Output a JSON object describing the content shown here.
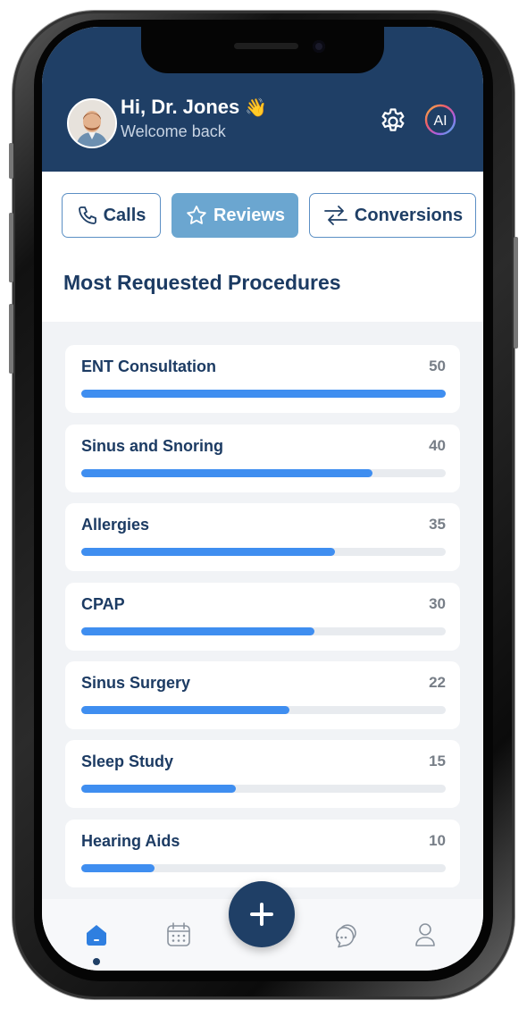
{
  "header": {
    "greeting": "Hi, Dr. Jones",
    "wave_emoji": "👋",
    "subtitle": "Welcome back",
    "ai_label": "AI"
  },
  "tabs": [
    {
      "label": "Calls",
      "icon": "phone-icon",
      "active": false
    },
    {
      "label": "Reviews",
      "icon": "star-icon",
      "active": true
    },
    {
      "label": "Conversions",
      "icon": "arrows-exchange-icon",
      "active": false
    }
  ],
  "section_title": "Most Requested Procedures",
  "procedures": [
    {
      "name": "ENT Consultation",
      "count": "50",
      "fraction": 1.0
    },
    {
      "name": "Sinus and Snoring",
      "count": "40",
      "fraction": 0.8
    },
    {
      "name": "Allergies",
      "count": "35",
      "fraction": 0.695
    },
    {
      "name": "CPAP",
      "count": "30",
      "fraction": 0.64
    },
    {
      "name": "Sinus Surgery",
      "count": "22",
      "fraction": 0.57
    },
    {
      "name": "Sleep Study",
      "count": "15",
      "fraction": 0.425
    },
    {
      "name": "Hearing Aids",
      "count": "10",
      "fraction": 0.2
    }
  ],
  "bottom_nav": [
    {
      "name": "home-icon",
      "active": true
    },
    {
      "name": "calendar-icon",
      "active": false
    },
    {
      "name": "chat-icon",
      "active": false
    },
    {
      "name": "profile-icon",
      "active": false
    }
  ],
  "colors": {
    "primary": "#1f3f66",
    "accent": "#3f8ef0",
    "active_tab": "#6ba6d0"
  }
}
